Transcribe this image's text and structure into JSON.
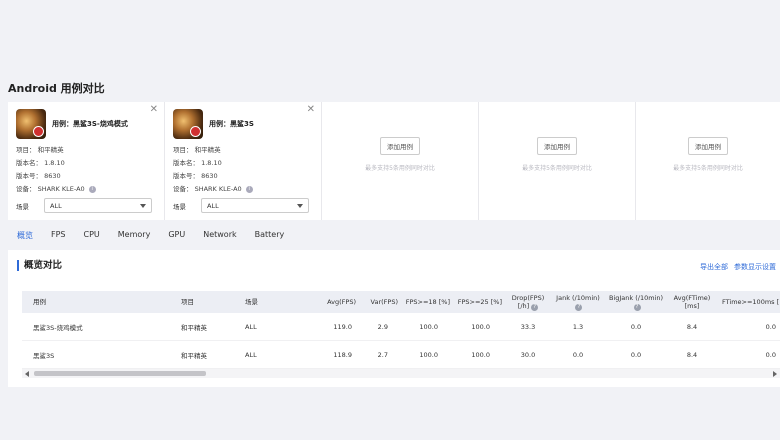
{
  "page": {
    "title": "Android 用例对比"
  },
  "cards": [
    {
      "case_label": "用例：黑鲨3S-烧鸡模式",
      "project": "项目： 和平精英",
      "version_name": "版本名： 1.8.10",
      "version_code": "版本号： 8630",
      "device": "设备： SHARK KLE-A0",
      "scene_label": "场景",
      "scene_value": "ALL"
    },
    {
      "case_label": "用例：黑鲨3S",
      "project": "项目： 和平精英",
      "version_name": "版本名： 1.8.10",
      "version_code": "版本号： 8630",
      "device": "设备： SHARK KLE-A0",
      "scene_label": "场景",
      "scene_value": "ALL"
    }
  ],
  "empty_slot": {
    "button": "添加用例",
    "hint": "最多支持5条用例同时对比"
  },
  "tabs": [
    "概览",
    "FPS",
    "CPU",
    "Memory",
    "GPU",
    "Network",
    "Battery"
  ],
  "active_tab": "概览",
  "overview": {
    "title": "概览对比",
    "export_all": "导出全部",
    "param_settings": "参数显示设置",
    "columns": [
      "用例",
      "项目",
      "场景",
      "Avg(FPS)",
      "Var(FPS)",
      "FPS>=18 [%]",
      "FPS>=25 [%]",
      "Drop(FPS) [/h]",
      "Jank (/10min)",
      "BigJank (/10min)",
      "Avg(FTime) [ms]",
      "FTime>=100ms ["
    ],
    "rows": [
      [
        "黑鲨3S-烧鸡模式",
        "和平精英",
        "ALL",
        "119.0",
        "2.9",
        "100.0",
        "100.0",
        "33.3",
        "1.3",
        "0.0",
        "8.4",
        "0.0"
      ],
      [
        "黑鲨3S",
        "和平精英",
        "ALL",
        "118.9",
        "2.7",
        "100.0",
        "100.0",
        "30.0",
        "0.0",
        "0.0",
        "8.4",
        "0.0"
      ]
    ]
  },
  "colors": {
    "accent": "#2f6bd8",
    "background": "#f1f2f6"
  },
  "icons": {
    "info": "info-icon",
    "close": "close-icon",
    "question": "question-icon"
  }
}
